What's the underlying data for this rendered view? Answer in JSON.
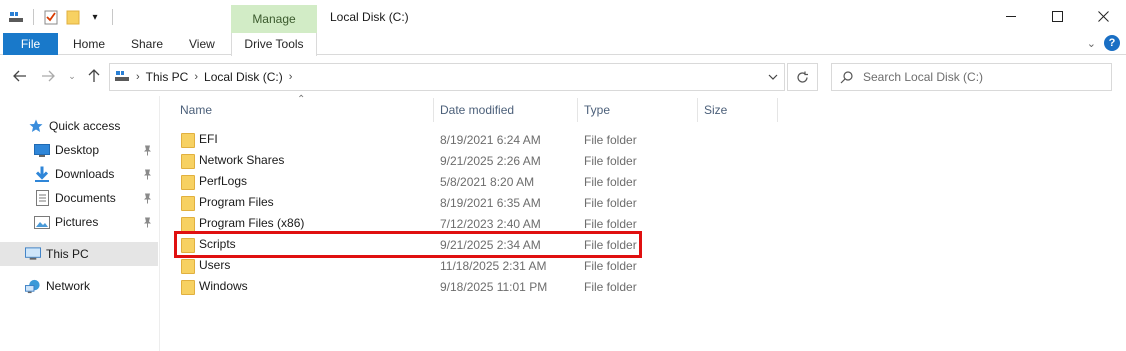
{
  "window": {
    "title": "Local Disk (C:)",
    "context_tab": "Manage",
    "minimize": "—",
    "maximize": "☐",
    "close": "✕"
  },
  "ribbon": {
    "tabs": [
      "File",
      "Home",
      "Share",
      "View",
      "Drive Tools"
    ],
    "help": "?"
  },
  "address": {
    "crumbs": [
      "This PC",
      "Local Disk (C:)"
    ]
  },
  "search": {
    "placeholder": "Search Local Disk (C:)"
  },
  "nav": {
    "items": [
      {
        "label": "Quick access",
        "icon": "star-icon",
        "pinned": false
      },
      {
        "label": "Desktop",
        "icon": "desktop-icon",
        "pinned": true
      },
      {
        "label": "Downloads",
        "icon": "download-icon",
        "pinned": true
      },
      {
        "label": "Documents",
        "icon": "documents-icon",
        "pinned": true
      },
      {
        "label": "Pictures",
        "icon": "pictures-icon",
        "pinned": true
      },
      {
        "label": "This PC",
        "icon": "computer-icon",
        "pinned": false,
        "selected": true
      },
      {
        "label": "Network",
        "icon": "network-icon",
        "pinned": false
      }
    ]
  },
  "columns": [
    "Name",
    "Date modified",
    "Type",
    "Size"
  ],
  "files": [
    {
      "name": "EFI",
      "date": "8/19/2021 6:24 AM",
      "type": "File folder"
    },
    {
      "name": "Network Shares",
      "date": "9/21/2025 2:26 AM",
      "type": "File folder"
    },
    {
      "name": "PerfLogs",
      "date": "5/8/2021 8:20 AM",
      "type": "File folder"
    },
    {
      "name": "Program Files",
      "date": "8/19/2021 6:35 AM",
      "type": "File folder"
    },
    {
      "name": "Program Files (x86)",
      "date": "7/12/2023 2:40 AM",
      "type": "File folder"
    },
    {
      "name": "Scripts",
      "date": "9/21/2025 2:34 AM",
      "type": "File folder",
      "highlighted": true
    },
    {
      "name": "Users",
      "date": "11/18/2025 2:31 AM",
      "type": "File folder"
    },
    {
      "name": "Windows",
      "date": "9/18/2025 11:01 PM",
      "type": "File folder"
    }
  ],
  "colors": {
    "file_tab": "#1979ca",
    "manage_tab": "#d2ecc6",
    "highlight": "#e01010",
    "selected_nav": "#e5e5e5"
  }
}
